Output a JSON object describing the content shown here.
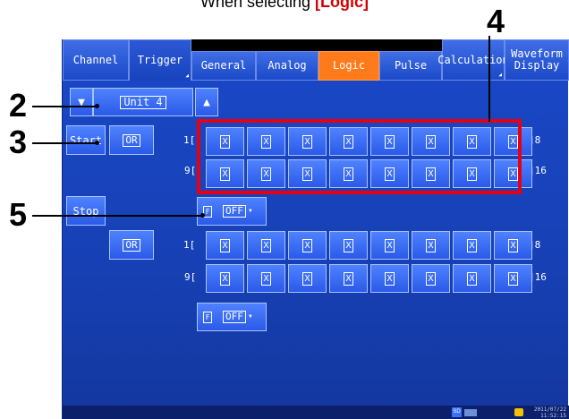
{
  "caption": {
    "prefix": "When selecting ",
    "highlight": "[Logic]"
  },
  "main_tabs": [
    "Channel",
    "Trigger",
    "Waveform Display"
  ],
  "sub_tabs": [
    "General",
    "Analog",
    "Logic",
    "Pulse",
    "Calculation"
  ],
  "active_sub_tab": "Logic",
  "unit_selector": {
    "prev": "▼",
    "value": "Unit 4",
    "next": "▲"
  },
  "start": {
    "label": "Start",
    "mode": "OR"
  },
  "stop": {
    "label": "Stop",
    "mode": "OR"
  },
  "row_labels": {
    "row1_start": "1[",
    "row1_end": "]8",
    "row2_start": "9[",
    "row2_end": "]16"
  },
  "start_pattern": {
    "row1": [
      "X",
      "X",
      "X",
      "X",
      "X",
      "X",
      "X",
      "X"
    ],
    "row2": [
      "X",
      "X",
      "X",
      "X",
      "X",
      "X",
      "X",
      "X"
    ]
  },
  "stop_pattern": {
    "row1": [
      "X",
      "X",
      "X",
      "X",
      "X",
      "X",
      "X",
      "X"
    ],
    "row2": [
      "X",
      "X",
      "X",
      "X",
      "X",
      "X",
      "X",
      "X"
    ]
  },
  "filter": {
    "icon": "F",
    "start_value": "OFF",
    "stop_value": "OFF"
  },
  "status": {
    "sd": "SD",
    "date": "2011/07/22",
    "time": "11:52:15"
  },
  "callouts": [
    "2",
    "3",
    "4",
    "5"
  ],
  "colors": {
    "screen_bg": "#1740b4",
    "active_tab": "#ff7a1a",
    "highlight_frame": "#e60012",
    "caption_highlight": "#d40000"
  }
}
